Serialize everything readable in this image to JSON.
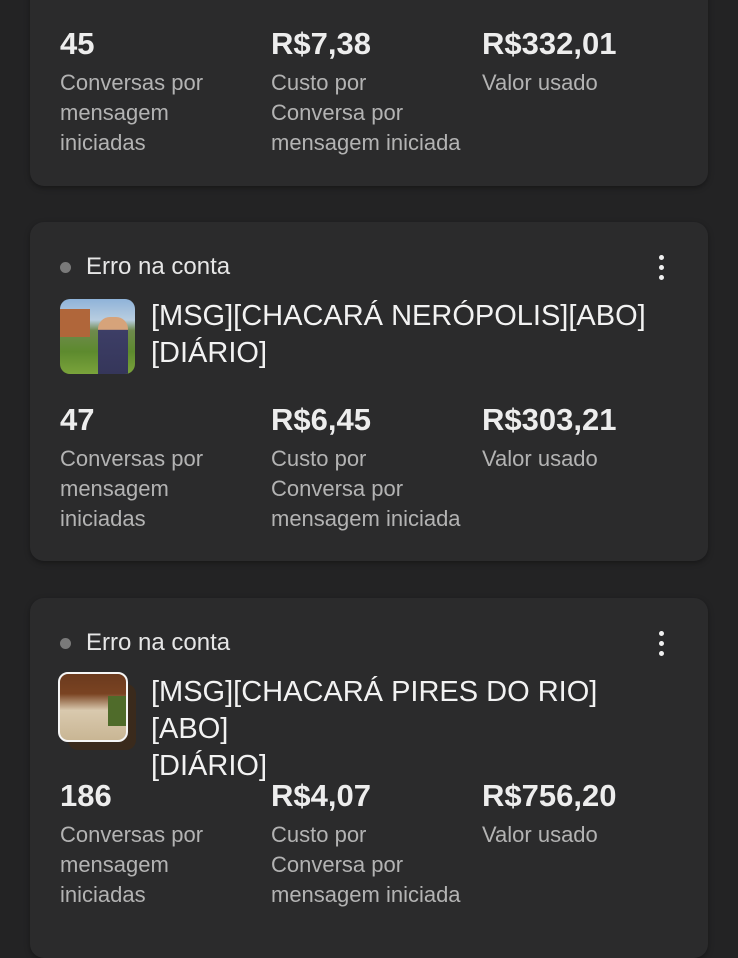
{
  "cards": [
    {
      "metrics": [
        {
          "value": "45",
          "label_lines": [
            "Conversas por",
            "mensagem",
            "iniciadas"
          ]
        },
        {
          "value": "R$7,38",
          "label_lines": [
            "Custo por",
            "Conversa por",
            "mensagem iniciada"
          ]
        },
        {
          "value": "R$332,01",
          "label_lines": [
            "Valor usado"
          ]
        }
      ]
    },
    {
      "status": "Erro na conta",
      "title_lines": [
        "[MSG][CHACARÁ NERÓPOLIS][ABO]",
        "[DIÁRIO]"
      ],
      "metrics": [
        {
          "value": "47",
          "label_lines": [
            "Conversas por",
            "mensagem",
            "iniciadas"
          ]
        },
        {
          "value": "R$6,45",
          "label_lines": [
            "Custo por",
            "Conversa por",
            "mensagem iniciada"
          ]
        },
        {
          "value": "R$303,21",
          "label_lines": [
            "Valor usado"
          ]
        }
      ]
    },
    {
      "status": "Erro na conta",
      "title_lines": [
        "[MSG][CHACARÁ PIRES DO RIO][ABO]",
        "[DIÁRIO]"
      ],
      "metrics": [
        {
          "value": "186",
          "label_lines": [
            "Conversas por",
            "mensagem",
            "iniciadas"
          ]
        },
        {
          "value": "R$4,07",
          "label_lines": [
            "Custo por",
            "Conversa por",
            "mensagem iniciada"
          ]
        },
        {
          "value": "R$756,20",
          "label_lines": [
            "Valor usado"
          ]
        }
      ]
    }
  ],
  "icons": {
    "more": "more-vertical-icon",
    "status": "status-dot-icon"
  },
  "colors": {
    "background": "#232324",
    "card": "#2b2b2c",
    "status_dot": "#7a7a7a",
    "text_primary": "#ededed",
    "text_secondary": "#b3b3b3"
  }
}
